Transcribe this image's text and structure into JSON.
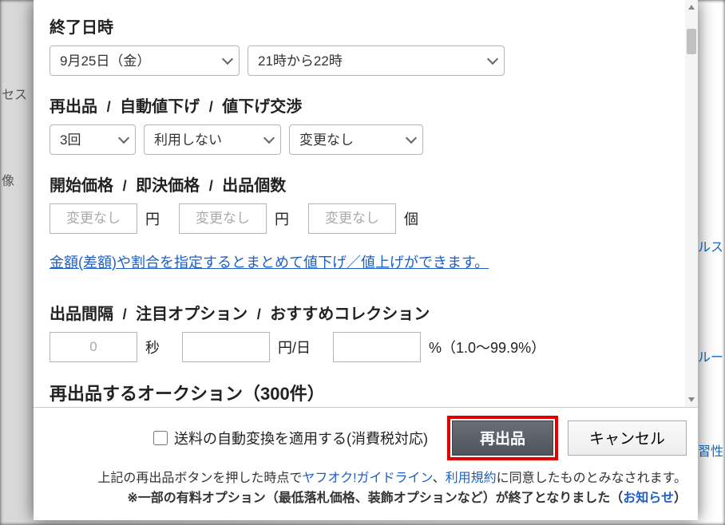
{
  "bg": {
    "t1": "セス",
    "t2": "像",
    "r1": "ルス",
    "r2": "ルー",
    "r3": "習性"
  },
  "endTime": {
    "label": "終了日時",
    "date": "9月25日（金）",
    "hours": "21時から22時"
  },
  "relistRow": {
    "relistLabel": "再出品",
    "autodownLabel": "自動値下げ",
    "negoLabel": "値下げ交渉",
    "relistValue": "3回",
    "autodownValue": "利用しない",
    "negoValue": "変更なし"
  },
  "priceRow": {
    "startLabel": "開始価格",
    "buyLabel": "即決価格",
    "qtyLabel": "出品個数",
    "ph": "変更なし",
    "unitYen": "円",
    "unitItem": "個"
  },
  "bulkLink": "金額(差額)や割合を指定するとまとめて値下げ／値上げができます。",
  "intervalRow": {
    "intervalLabel": "出品間隔",
    "featuredLabel": "注目オプション",
    "recommendLabel": "おすすめコレクション",
    "intervalPh": "0",
    "unitSec": "秒",
    "unitYenDay": "円/日",
    "unitPct": "%（1.0～99.9%）"
  },
  "cutoffTitle": "再出品するオークション（300件）",
  "footer": {
    "autoShip": "送料の自動変換を適用する(消費税対応)",
    "relistBtn": "再出品",
    "cancelBtn": "キャンセル",
    "line1a": "上記の再出品ボタンを押した時点で",
    "line1link1": "ヤフオク!ガイドライン",
    "line1sep": "、",
    "line1link2": "利用規約",
    "line1b": "に同意したものとみなされます。",
    "line2a": "※一部の有料オプション（最低落札価格、装飾オプションなど）が終了となりました",
    "line2open": "（",
    "line2link": "お知らせ",
    "line2close": "）"
  }
}
